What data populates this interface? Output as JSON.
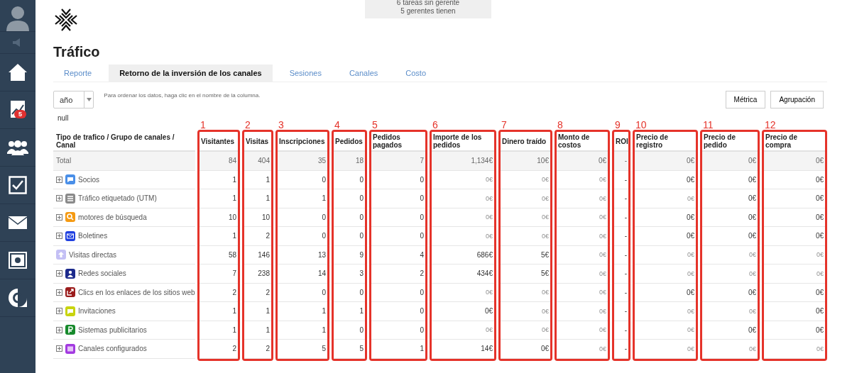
{
  "sidebar": {
    "items": [
      {
        "kind": "avatar"
      },
      {
        "kind": "speaker"
      },
      {
        "kind": "home"
      },
      {
        "kind": "chart",
        "badge": "5"
      },
      {
        "kind": "people"
      },
      {
        "kind": "check"
      },
      {
        "kind": "mail"
      },
      {
        "kind": "safe"
      },
      {
        "kind": "logo"
      }
    ]
  },
  "notice": {
    "lines": [
      "6 tareas sin gerente",
      "5 gerentes tienen"
    ]
  },
  "title": "Tráfico",
  "tabs": [
    {
      "label": "Reporte",
      "selected": false
    },
    {
      "label": "Retorno de la inversión de los canales",
      "selected": true
    },
    {
      "label": "Sesiones",
      "selected": false
    },
    {
      "label": "Canales",
      "selected": false
    },
    {
      "label": "Costo",
      "selected": false
    }
  ],
  "period": {
    "value": "año"
  },
  "hint": "Para ordenar los datos, haga clic en el nombre de la columna.",
  "buttons": [
    "Métrica",
    "Agrupación"
  ],
  "null_label": "null",
  "table": {
    "name_column": {
      "label": "Tipo de trafico / Grupo de canales / Canal"
    },
    "columns": [
      {
        "label": "Visitantes",
        "marker": "1"
      },
      {
        "label": "Visitas",
        "marker": "2"
      },
      {
        "label": "Inscripciones",
        "marker": "3"
      },
      {
        "label": "Pedidos",
        "marker": "4"
      },
      {
        "label": "Pedidos pagados",
        "marker": "5"
      },
      {
        "label": "Importe de los pedidos",
        "marker": "6"
      },
      {
        "label": "Dinero traído",
        "marker": "7"
      },
      {
        "label": "Monto de costos",
        "marker": "8"
      },
      {
        "label": "ROI",
        "marker": "9"
      },
      {
        "label": "Precio de registro",
        "marker": "10"
      },
      {
        "label": "Precio de pedido",
        "marker": "11"
      },
      {
        "label": "Precio de compra",
        "marker": "12"
      }
    ],
    "rows": [
      {
        "kind": "total",
        "name": "Total",
        "expandable": false,
        "cells": [
          {
            "text": "84",
            "muted": false
          },
          {
            "text": "404",
            "muted": false
          },
          {
            "text": "35",
            "muted": false
          },
          {
            "text": "18",
            "muted": false
          },
          {
            "text": "7",
            "muted": false
          },
          {
            "text": "1,134€",
            "muted": false
          },
          {
            "text": "10€",
            "muted": false
          },
          {
            "text": "0€",
            "muted": false
          },
          {
            "text": "-",
            "muted": false
          },
          {
            "text": "0€",
            "muted": false
          },
          {
            "text": "0€",
            "muted": false
          },
          {
            "text": "0€",
            "muted": false
          }
        ]
      },
      {
        "kind": "chat",
        "color": "#4a8fe8",
        "name": "Socios",
        "expandable": true,
        "cells": [
          {
            "text": "1",
            "muted": false
          },
          {
            "text": "1",
            "muted": false
          },
          {
            "text": "0",
            "muted": false
          },
          {
            "text": "0",
            "muted": false
          },
          {
            "text": "0",
            "muted": false
          },
          {
            "text": "0€",
            "muted": true
          },
          {
            "text": "0€",
            "muted": true
          },
          {
            "text": "0€",
            "muted": true
          },
          {
            "text": "-",
            "muted": false
          },
          {
            "text": "0€",
            "muted": false
          },
          {
            "text": "0€",
            "muted": false
          },
          {
            "text": "0€",
            "muted": false
          }
        ]
      },
      {
        "kind": "list",
        "color": "#8a8a8a",
        "name": "Tráfico etiquetado (UTM)",
        "expandable": true,
        "cells": [
          {
            "text": "1",
            "muted": false
          },
          {
            "text": "1",
            "muted": false
          },
          {
            "text": "1",
            "muted": false
          },
          {
            "text": "0",
            "muted": false
          },
          {
            "text": "0",
            "muted": false
          },
          {
            "text": "0€",
            "muted": true
          },
          {
            "text": "0€",
            "muted": true
          },
          {
            "text": "0€",
            "muted": true
          },
          {
            "text": "-",
            "muted": false
          },
          {
            "text": "0€",
            "muted": true
          },
          {
            "text": "0€",
            "muted": false
          },
          {
            "text": "0€",
            "muted": false
          }
        ]
      },
      {
        "kind": "search",
        "color": "#f59a12",
        "name": "motores de búsqueda",
        "expandable": true,
        "cells": [
          {
            "text": "10",
            "muted": false
          },
          {
            "text": "10",
            "muted": false
          },
          {
            "text": "0",
            "muted": false
          },
          {
            "text": "0",
            "muted": false
          },
          {
            "text": "0",
            "muted": false
          },
          {
            "text": "0€",
            "muted": true
          },
          {
            "text": "0€",
            "muted": true
          },
          {
            "text": "0€",
            "muted": true
          },
          {
            "text": "-",
            "muted": false
          },
          {
            "text": "0€",
            "muted": false
          },
          {
            "text": "0€",
            "muted": false
          },
          {
            "text": "0€",
            "muted": false
          }
        ]
      },
      {
        "kind": "mail",
        "color": "#1e3fe0",
        "name": "Boletines",
        "expandable": true,
        "cells": [
          {
            "text": "1",
            "muted": false
          },
          {
            "text": "2",
            "muted": false
          },
          {
            "text": "0",
            "muted": false
          },
          {
            "text": "0",
            "muted": false
          },
          {
            "text": "0",
            "muted": false
          },
          {
            "text": "0€",
            "muted": true
          },
          {
            "text": "0€",
            "muted": true
          },
          {
            "text": "0€",
            "muted": true
          },
          {
            "text": "-",
            "muted": false
          },
          {
            "text": "0€",
            "muted": false
          },
          {
            "text": "0€",
            "muted": false
          },
          {
            "text": "0€",
            "muted": false
          }
        ]
      },
      {
        "kind": "arrow",
        "color": "#c4c0f5",
        "name": "Visitas directas",
        "expandable": false,
        "cells": [
          {
            "text": "58",
            "muted": false
          },
          {
            "text": "146",
            "muted": false
          },
          {
            "text": "13",
            "muted": false
          },
          {
            "text": "9",
            "muted": false
          },
          {
            "text": "4",
            "muted": false
          },
          {
            "text": "686€",
            "muted": false
          },
          {
            "text": "5€",
            "muted": false
          },
          {
            "text": "0€",
            "muted": true
          },
          {
            "text": "-",
            "muted": false
          },
          {
            "text": "0€",
            "muted": true
          },
          {
            "text": "0€",
            "muted": true
          },
          {
            "text": "0€",
            "muted": true
          }
        ]
      },
      {
        "kind": "person",
        "color": "#1c2a8c",
        "name": "Redes sociales",
        "expandable": true,
        "cells": [
          {
            "text": "7",
            "muted": false
          },
          {
            "text": "238",
            "muted": false
          },
          {
            "text": "14",
            "muted": false
          },
          {
            "text": "3",
            "muted": false
          },
          {
            "text": "2",
            "muted": false
          },
          {
            "text": "434€",
            "muted": false
          },
          {
            "text": "5€",
            "muted": false
          },
          {
            "text": "0€",
            "muted": true
          },
          {
            "text": "-",
            "muted": false
          },
          {
            "text": "0€",
            "muted": true
          },
          {
            "text": "0€",
            "muted": true
          },
          {
            "text": "0€",
            "muted": true
          }
        ]
      },
      {
        "kind": "link",
        "color": "#9b1c1c",
        "name": "Clics en los enlaces de los sitios web",
        "expandable": true,
        "cells": [
          {
            "text": "2",
            "muted": false
          },
          {
            "text": "2",
            "muted": false
          },
          {
            "text": "0",
            "muted": false
          },
          {
            "text": "0",
            "muted": false
          },
          {
            "text": "0",
            "muted": false
          },
          {
            "text": "0€",
            "muted": true
          },
          {
            "text": "0€",
            "muted": true
          },
          {
            "text": "0€",
            "muted": true
          },
          {
            "text": "-",
            "muted": false
          },
          {
            "text": "0€",
            "muted": false
          },
          {
            "text": "0€",
            "muted": false
          },
          {
            "text": "0€",
            "muted": false
          }
        ]
      },
      {
        "kind": "chat",
        "color": "#c8d40e",
        "name": "Invitaciones",
        "expandable": true,
        "cells": [
          {
            "text": "1",
            "muted": false
          },
          {
            "text": "1",
            "muted": false
          },
          {
            "text": "1",
            "muted": false
          },
          {
            "text": "1",
            "muted": false
          },
          {
            "text": "0",
            "muted": false
          },
          {
            "text": "0€",
            "muted": false
          },
          {
            "text": "0€",
            "muted": true
          },
          {
            "text": "0€",
            "muted": true
          },
          {
            "text": "-",
            "muted": false
          },
          {
            "text": "0€",
            "muted": true
          },
          {
            "text": "0€",
            "muted": true
          },
          {
            "text": "0€",
            "muted": false
          }
        ]
      },
      {
        "kind": "ruble",
        "color": "#178a2c",
        "name": "Sistemas publicitarios",
        "expandable": true,
        "cells": [
          {
            "text": "1",
            "muted": false
          },
          {
            "text": "1",
            "muted": false
          },
          {
            "text": "1",
            "muted": false
          },
          {
            "text": "0",
            "muted": false
          },
          {
            "text": "0",
            "muted": false
          },
          {
            "text": "0€",
            "muted": true
          },
          {
            "text": "0€",
            "muted": true
          },
          {
            "text": "0€",
            "muted": true
          },
          {
            "text": "-",
            "muted": false
          },
          {
            "text": "0€",
            "muted": true
          },
          {
            "text": "0€",
            "muted": false
          },
          {
            "text": "0€",
            "muted": false
          }
        ]
      },
      {
        "kind": "window",
        "color": "#a33ae0",
        "name": "Canales configurados",
        "expandable": true,
        "cells": [
          {
            "text": "2",
            "muted": false
          },
          {
            "text": "2",
            "muted": false
          },
          {
            "text": "5",
            "muted": false
          },
          {
            "text": "5",
            "muted": false
          },
          {
            "text": "1",
            "muted": false
          },
          {
            "text": "14€",
            "muted": false
          },
          {
            "text": "0€",
            "muted": false
          },
          {
            "text": "0€",
            "muted": true
          },
          {
            "text": "-",
            "muted": false
          },
          {
            "text": "0€",
            "muted": true
          },
          {
            "text": "0€",
            "muted": true
          },
          {
            "text": "0€",
            "muted": true
          }
        ]
      }
    ]
  }
}
